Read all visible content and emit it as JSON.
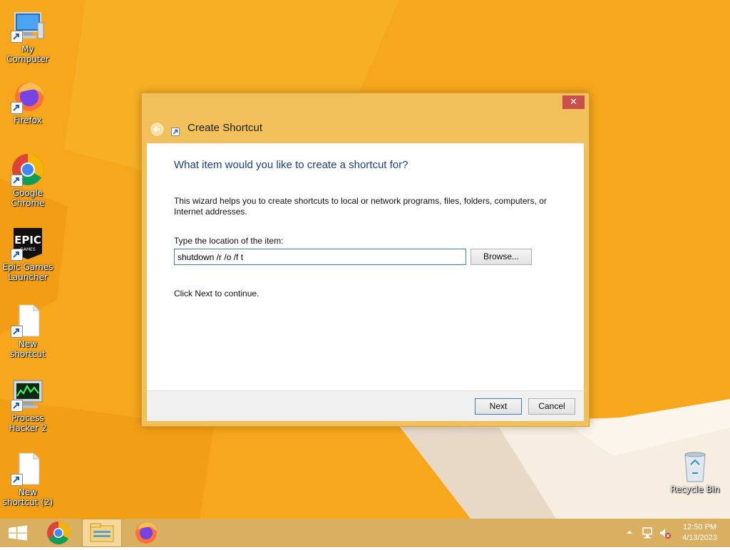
{
  "desktop": {
    "icons": [
      {
        "label": "My Computer",
        "icon": "computer-icon"
      },
      {
        "label": "Firefox",
        "icon": "firefox-icon"
      },
      {
        "label": "Google Chrome",
        "icon": "chrome-icon"
      },
      {
        "label": "Epic Games Launcher",
        "icon": "epic-games-icon"
      },
      {
        "label": "New shortcut",
        "icon": "blank-file-icon"
      },
      {
        "label": "Process Hacker 2",
        "icon": "process-hacker-icon"
      },
      {
        "label": "New shortcut (2)",
        "icon": "blank-file-icon"
      },
      {
        "label": "Recycle Bin",
        "icon": "recycle-bin-icon"
      }
    ],
    "epic_logo_text": "EPIC",
    "epic_logo_sub": "GAMES"
  },
  "dialog": {
    "title": "Create Shortcut",
    "close_glyph": "✕",
    "heading": "What item would you like to create a shortcut for?",
    "description": "This wizard helps you to create shortcuts to local or network programs, files, folders, computers, or Internet addresses.",
    "location_label": "Type the location of the item:",
    "location_value": "shutdown /r /o /f t",
    "browse_label": "Browse...",
    "continue_text": "Click Next to continue.",
    "next_label": "Next",
    "cancel_label": "Cancel"
  },
  "taskbar": {
    "items": [
      "start-button",
      "chrome",
      "file-explorer",
      "firefox"
    ],
    "time": "12:50 PM",
    "date": "4/13/2023"
  },
  "colors": {
    "wallpaper": "#f6a71b",
    "taskbar": "#d9b061",
    "dialog_frame": "#f2c05a",
    "heading_text": "#1f3f76",
    "close_button": "#c7504a"
  }
}
